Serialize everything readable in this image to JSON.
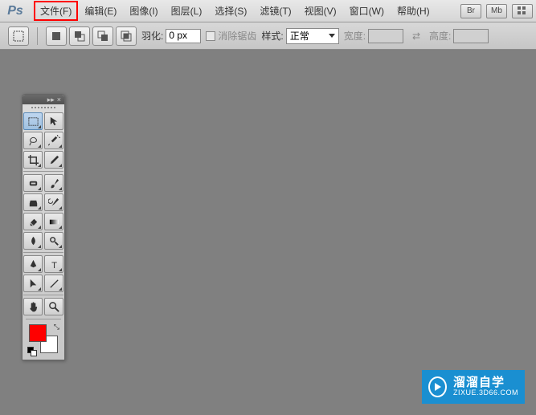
{
  "app": {
    "logo_text": "Ps"
  },
  "menu": {
    "items": [
      {
        "label": "文件(F)",
        "highlighted": true
      },
      {
        "label": "编辑(E)"
      },
      {
        "label": "图像(I)"
      },
      {
        "label": "图层(L)"
      },
      {
        "label": "选择(S)"
      },
      {
        "label": "滤镜(T)"
      },
      {
        "label": "视图(V)"
      },
      {
        "label": "窗口(W)"
      },
      {
        "label": "帮助(H)"
      }
    ],
    "right_buttons": [
      "Br",
      "Mb"
    ]
  },
  "options": {
    "feather_label": "羽化:",
    "feather_value": "0 px",
    "antialias_label": "消除锯齿",
    "style_label": "样式:",
    "style_value": "正常",
    "width_label": "宽度:",
    "width_value": "",
    "swap_glyph": "⇄",
    "height_label": "高度:",
    "height_value": ""
  },
  "tools": {
    "names": [
      "rectangular-marquee-tool",
      "move-tool",
      "lasso-tool",
      "magic-wand-tool",
      "crop-tool",
      "eyedropper-tool",
      "healing-brush-tool",
      "brush-tool",
      "clone-stamp-tool",
      "history-brush-tool",
      "eraser-tool",
      "gradient-tool",
      "blur-tool",
      "dodge-tool",
      "pen-tool",
      "type-tool",
      "path-selection-tool",
      "line-tool",
      "hand-tool",
      "zoom-tool"
    ],
    "selected_index": 0
  },
  "colors": {
    "foreground": "#ff0000",
    "background": "#ffffff"
  },
  "watermark": {
    "title": "溜溜自学",
    "url": "ZIXUE.3D66.COM"
  }
}
